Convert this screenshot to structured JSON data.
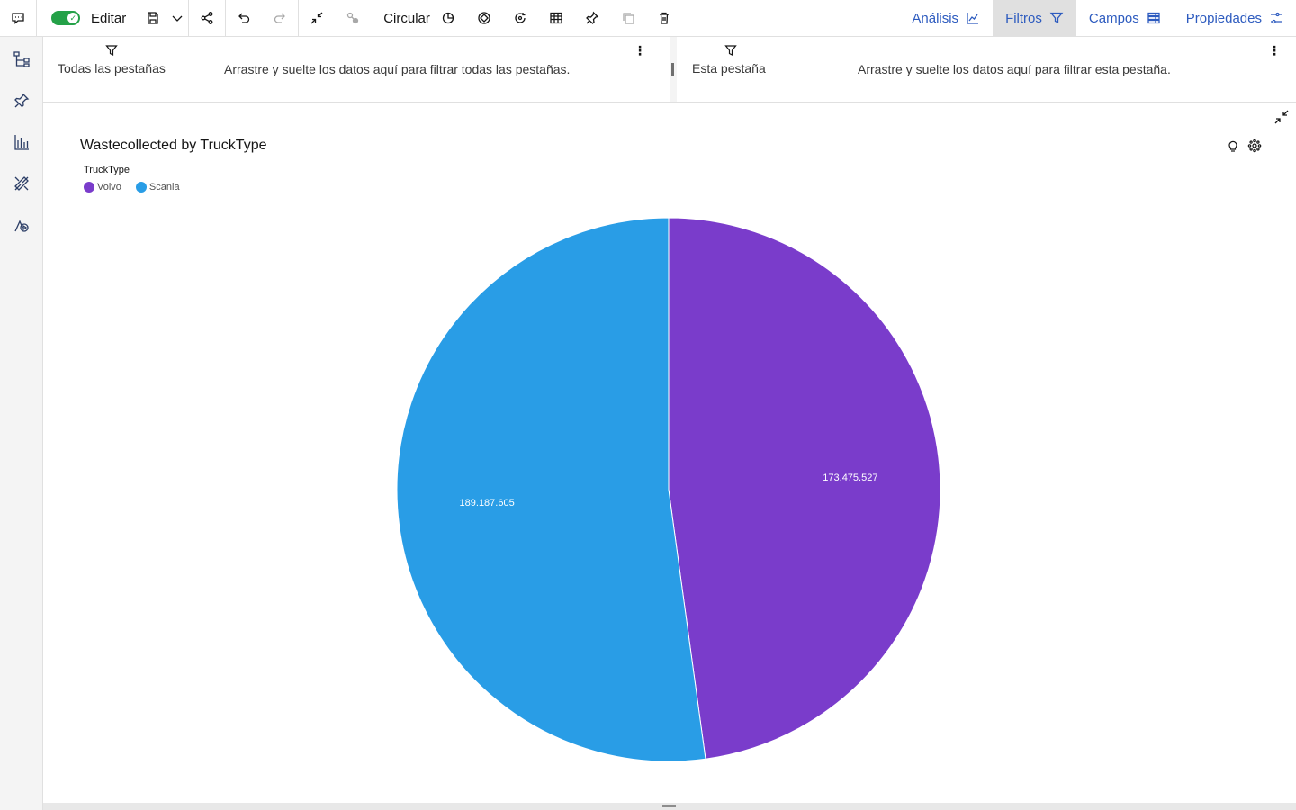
{
  "toolbar": {
    "edit_label": "Editar",
    "chart_type_label": "Circular"
  },
  "right_tabs": [
    {
      "label": "Análisis",
      "icon": "analysis-chart-icon",
      "active": false
    },
    {
      "label": "Filtros",
      "icon": "filter-icon",
      "active": true
    },
    {
      "label": "Campos",
      "icon": "fields-icon",
      "active": false
    },
    {
      "label": "Propiedades",
      "icon": "sliders-icon",
      "active": false
    }
  ],
  "filters": {
    "all_tabs": {
      "title": "Todas las pestañas",
      "hint": "Arrastre y suelte los datos aquí para filtrar todas las pestañas."
    },
    "this_tab": {
      "title": "Esta pestaña",
      "hint": "Arrastre y suelte los datos aquí para filtrar esta pestaña."
    }
  },
  "chart": {
    "title": "Wastecollected by TruckType",
    "legend_title": "TruckType"
  },
  "colors": {
    "Volvo": "#7a3ccb",
    "Scania": "#299de6"
  },
  "chart_data": {
    "type": "pie",
    "title": "Wastecollected by TruckType",
    "legend_title": "TruckType",
    "legend_placement": "top-left",
    "slices": [
      {
        "label": "Volvo",
        "value": 173475527,
        "display": "173.475.527",
        "color": "#7a3ccb"
      },
      {
        "label": "Scania",
        "value": 189187605,
        "display": "189.187.605",
        "color": "#299de6"
      }
    ]
  }
}
